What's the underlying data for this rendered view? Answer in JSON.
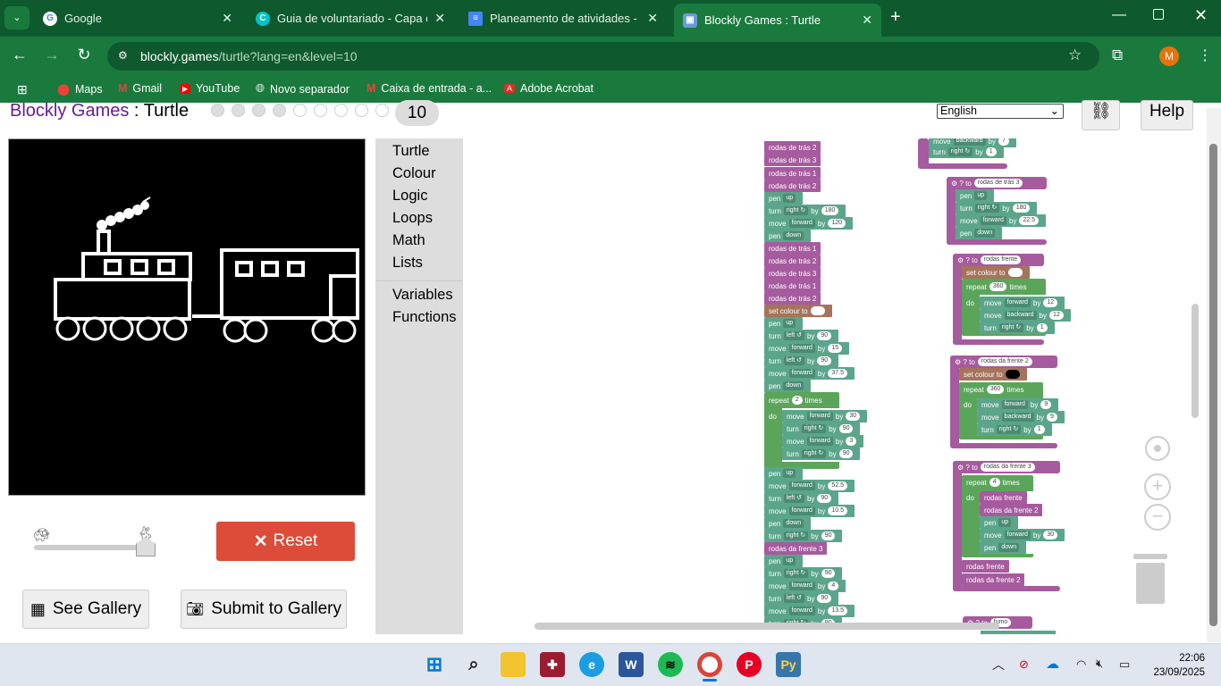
{
  "browser": {
    "tabs": [
      {
        "title": "Google",
        "active": false
      },
      {
        "title": "Guia de voluntariado - Capa de",
        "active": false
      },
      {
        "title": "Planeamento de atividades - Go",
        "active": false
      },
      {
        "title": "Blockly Games : Turtle",
        "active": true
      }
    ],
    "url_host": "blockly.games",
    "url_path": "/turtle?lang=en&level=10",
    "profile_initial": "M",
    "bookmarks": [
      "Maps",
      "Gmail",
      "YouTube",
      "Novo separador",
      "Caixa de entrada - a...",
      "Adobe Acrobat"
    ]
  },
  "game": {
    "title_game": "Blockly Games",
    "title_sep": " : ",
    "title_level": "Turtle",
    "level_number": "10",
    "language": "English",
    "help_label": "Help",
    "reset_label": "Reset",
    "see_gallery_label": "See Gallery",
    "submit_gallery_label": "Submit to Gallery",
    "speed_fraction": 1.0
  },
  "toolbox": {
    "categories": [
      "Turtle",
      "Colour",
      "Logic",
      "Loops",
      "Math",
      "Lists"
    ],
    "categories2": [
      "Variables",
      "Functions"
    ]
  },
  "blocks": {
    "rodas_tras_2": "rodas de trás 2",
    "rodas_tras_3": "rodas de trás 3",
    "rodas_tras_1": "rodas de trás 1",
    "rodas_frente": "rodas frente",
    "rodas_frente_2": "rodas da frente 2",
    "rodas_frente_3": "rodas da frente 3",
    "fumo": "fumo",
    "to": "to",
    "pen": "pen",
    "up": "up",
    "down": "down",
    "turn": "turn",
    "move": "move",
    "by": "by",
    "forward": "forward",
    "backward": "backward",
    "right": "right ↻",
    "left": "left ↺",
    "set_colour": "set colour to",
    "repeat": "repeat",
    "times": "times",
    "do": "do",
    "n180": "180",
    "n120": "120",
    "n90": "90",
    "n15": "15",
    "n37_5": "37.5",
    "n2": "2",
    "n30": "30",
    "n3": "3",
    "n52_5": "52.5",
    "n10_5": "10.5",
    "n4": "4",
    "n13_5": "13.5",
    "n22_5": "22.5",
    "n360": "360",
    "n12": "12",
    "n1": "1",
    "n9": "9",
    "n7": "7"
  },
  "taskbar": {
    "time": "22:06",
    "date": "23/09/2025"
  },
  "colors": {
    "browser_dark": "#0e5a2e",
    "browser_light": "#1a7a3e",
    "procedure": "#a55b9e",
    "turtle": "#5ba58b",
    "reset": "#dd4b39"
  }
}
